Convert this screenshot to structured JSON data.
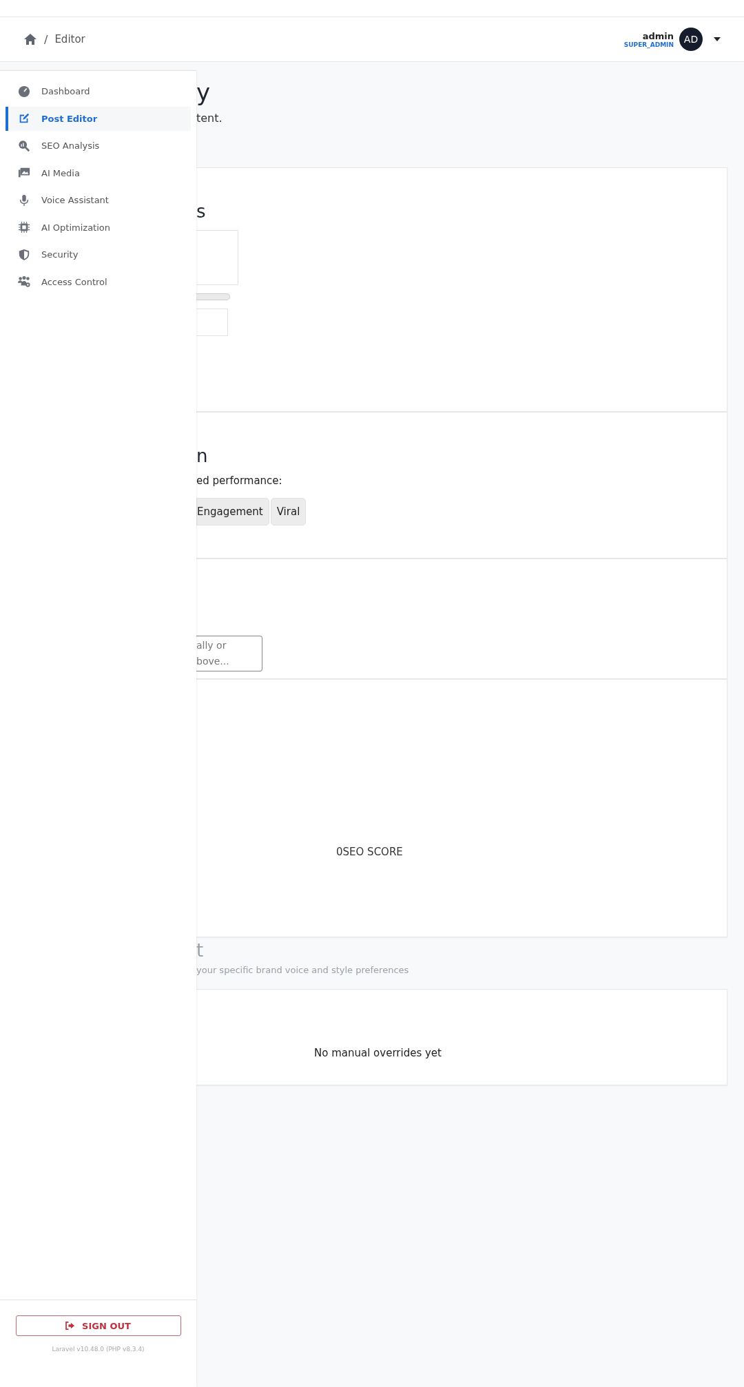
{
  "header": {
    "breadcrumb": [
      {
        "separator": "/",
        "label": "Editor"
      }
    ],
    "user": {
      "name": "admin",
      "role": "SUPER_ADMIN",
      "initials": "AD"
    }
  },
  "sidebar": {
    "items": [
      {
        "label": "Dashboard",
        "selected": false
      },
      {
        "label": "Post Editor",
        "selected": true
      },
      {
        "label": "SEO Analysis",
        "selected": false
      },
      {
        "label": "AI Media",
        "selected": false
      },
      {
        "label": "Voice Assistant",
        "selected": false
      },
      {
        "label": "AI Optimization",
        "selected": false
      },
      {
        "label": "Security",
        "selected": false
      },
      {
        "label": "Access Control",
        "selected": false
      }
    ],
    "sign_out": "SIGN OUT",
    "version": "Laravel v10.48.0 (PHP v8.3.4)"
  },
  "page": {
    "title": "y",
    "subtitle": "tent."
  },
  "cards": [
    {
      "kind": "settings",
      "heading": "s"
    },
    {
      "kind": "options",
      "heading": "n",
      "text": "ed performance:",
      "buttons": [
        {
          "label": "Engagement",
          "selected": false
        },
        {
          "label": "Viral",
          "selected": false
        }
      ]
    },
    {
      "kind": "input",
      "placeholder": "ally or\nbove..."
    },
    {
      "kind": "score",
      "text": "0SEO SCORE"
    },
    {
      "kind": "section",
      "heading": "t",
      "text": "your specific brand voice and style preferences"
    },
    {
      "kind": "empty",
      "text": "No manual overrides yet"
    }
  ]
}
